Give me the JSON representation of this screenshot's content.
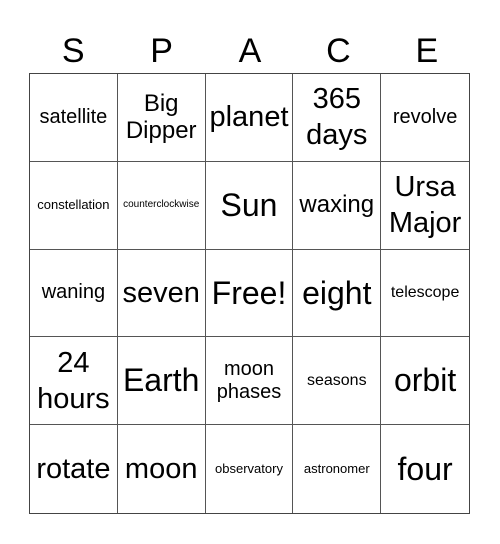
{
  "header": {
    "letters": [
      "S",
      "P",
      "A",
      "C",
      "E"
    ]
  },
  "cells": [
    {
      "text": "satellite",
      "size": "s-md"
    },
    {
      "text": "Big Dipper",
      "size": "s-lg"
    },
    {
      "text": "planet",
      "size": "s-xl"
    },
    {
      "text": "365 days",
      "size": "s-xl"
    },
    {
      "text": "revolve",
      "size": "s-md"
    },
    {
      "text": "constellation",
      "size": "s-sm"
    },
    {
      "text": "counterclockwise",
      "size": "s-xs"
    },
    {
      "text": "Sun",
      "size": "s-xxl"
    },
    {
      "text": "waxing",
      "size": "s-lg"
    },
    {
      "text": "Ursa Major",
      "size": "s-xl"
    },
    {
      "text": "waning",
      "size": "s-md"
    },
    {
      "text": "seven",
      "size": "s-xl"
    },
    {
      "text": "Free!",
      "size": "s-xxl"
    },
    {
      "text": "eight",
      "size": "s-xxl"
    },
    {
      "text": "telescope",
      "size": "s-sm2"
    },
    {
      "text": "24 hours",
      "size": "s-xl"
    },
    {
      "text": "Earth",
      "size": "s-xxl"
    },
    {
      "text": "moon phases",
      "size": "s-md"
    },
    {
      "text": "seasons",
      "size": "s-sm2"
    },
    {
      "text": "orbit",
      "size": "s-xxl"
    },
    {
      "text": "rotate",
      "size": "s-xl"
    },
    {
      "text": "moon",
      "size": "s-xl"
    },
    {
      "text": "observatory",
      "size": "s-sm"
    },
    {
      "text": "astronomer",
      "size": "s-sm"
    },
    {
      "text": "four",
      "size": "s-xxl"
    }
  ]
}
